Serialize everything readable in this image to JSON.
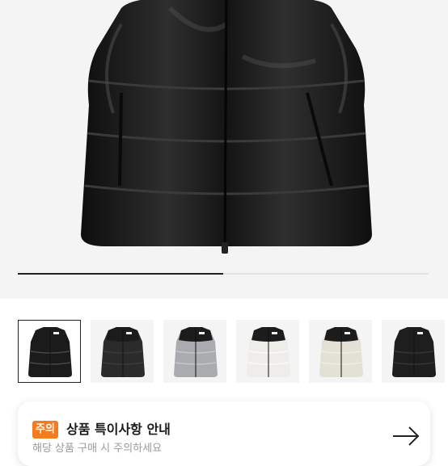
{
  "gallery": {
    "current_index": 1,
    "total": 6,
    "progress_fraction": 0.5,
    "thumbnails": [
      {
        "label": "glossy black vest",
        "body": "#1b1b1b",
        "top": "#1b1b1b",
        "shine": "#5a5a5a"
      },
      {
        "label": "matte black vest",
        "body": "#2b2b2b",
        "top": "#1c1c1c",
        "shine": "#444444"
      },
      {
        "label": "grey vest",
        "body": "#a9abae",
        "top": "#1c1c1c",
        "shine": "#d0d2d4"
      },
      {
        "label": "white vest",
        "body": "#efedea",
        "top": "#1c1c1c",
        "shine": "#ffffff"
      },
      {
        "label": "cream vest",
        "body": "#e3e0d6",
        "top": "#1c1c1c",
        "shine": "#f4f2ec"
      },
      {
        "label": "black vest",
        "body": "#1e1e1e",
        "top": "#1e1e1e",
        "shine": "#3e3e3e"
      }
    ]
  },
  "notice": {
    "badge": "주의",
    "title": "상품 특이사항 안내",
    "subtitle": "해당 상품 구매 시 주의하세요"
  },
  "colors": {
    "accent": "#f47c20"
  }
}
